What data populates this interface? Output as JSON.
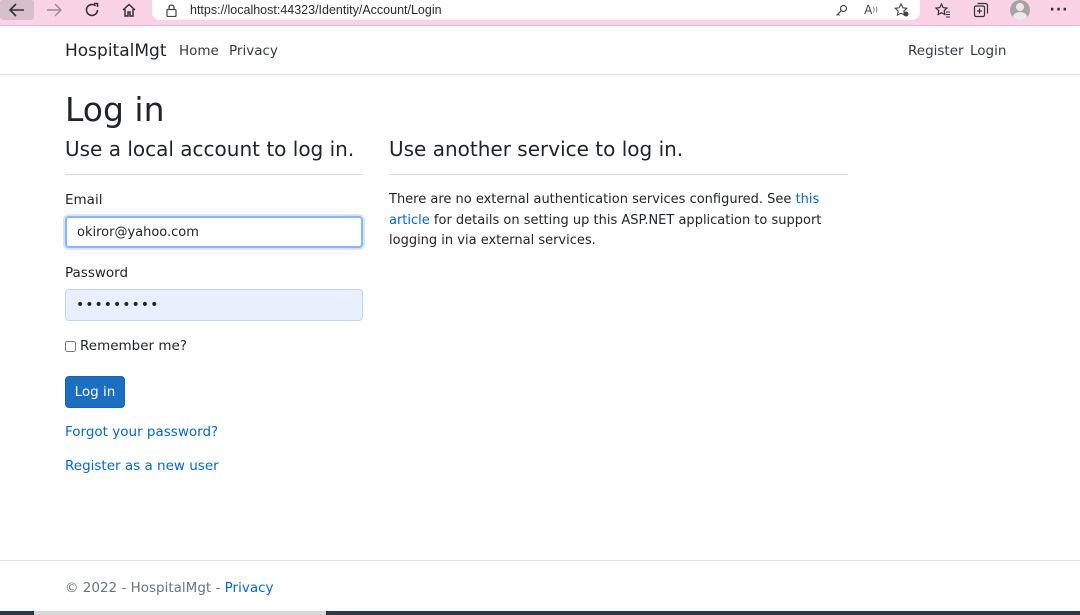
{
  "browser": {
    "url": "https://localhost:44323/Identity/Account/Login",
    "icons": [
      "back-icon",
      "forward-icon",
      "reload-icon",
      "home-icon",
      "lock-icon",
      "key-icon",
      "read-aloud-icon",
      "favorite-add-icon",
      "favorites-icon",
      "collections-icon",
      "profile-icon",
      "more-icon"
    ]
  },
  "navbar": {
    "brand": "HospitalMgt",
    "links": [
      "Home",
      "Privacy"
    ],
    "right_links": [
      "Register",
      "Login"
    ]
  },
  "main": {
    "title": "Log in",
    "local_section": {
      "heading": "Use a local account to log in.",
      "email_label": "Email",
      "email_value": "okiror@yahoo.com",
      "password_label": "Password",
      "password_value": "•••••••••",
      "remember_label": "Remember me?",
      "remember_checked": false,
      "login_button": "Log in",
      "forgot_link": "Forgot your password?",
      "register_link": "Register as a new user"
    },
    "external_section": {
      "heading": "Use another service to log in.",
      "text_before": "There are no external authentication services configured. See ",
      "link_text": "this article",
      "text_after": " for details on setting up this ASP.NET application to support logging in via external services."
    }
  },
  "footer": {
    "text": "© 2022 - HospitalMgt - ",
    "privacy_link": "Privacy"
  },
  "colors": {
    "link": "#0366d6",
    "primary_button": "#1b6ec2",
    "browser_bar": "#fbd3e6"
  }
}
